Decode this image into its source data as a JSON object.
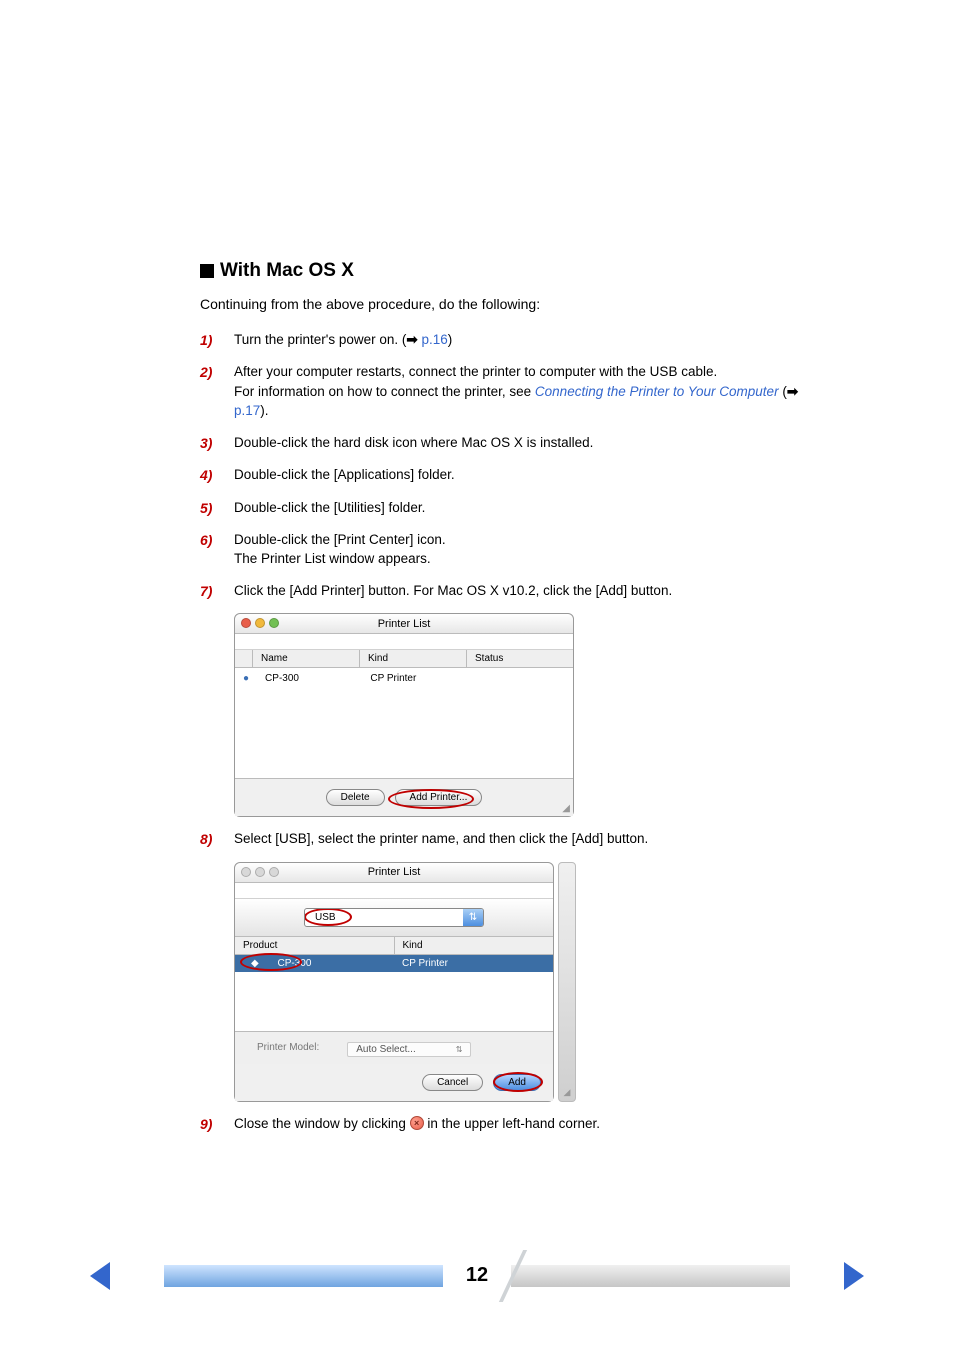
{
  "heading": "With Mac OS X",
  "intro": "Continuing from the above procedure, do the following:",
  "steps": [
    {
      "num": "1)",
      "body": "Turn the printer's power on. (",
      "arrow": "➡",
      "pageRef": "p.16",
      "tail": ")"
    },
    {
      "num": "2)",
      "body": "After your computer restarts, connect the printer to computer with the USB cable.",
      "body2": "For information on how to connect the printer, see ",
      "linkText": "Connecting the Printer to Your Computer",
      "tailArrowOpen": " (",
      "arrow": "➡",
      "pageRef": "p.17",
      "tailArrowClose": ")."
    },
    {
      "num": "3)",
      "body": "Double-click the hard disk icon where Mac OS X is installed."
    },
    {
      "num": "4)",
      "body": "Double-click the [Applications] folder."
    },
    {
      "num": "5)",
      "body": "Double-click the [Utilities] folder."
    },
    {
      "num": "6)",
      "body": "Double-click the [Print Center] icon.",
      "body2": "The Printer List window appears."
    },
    {
      "num": "7)",
      "body": "Click the [Add Printer] button. For Mac OS X v10.2, click the [Add] button."
    },
    {
      "num": "8)",
      "body": "Select [USB], select the printer name, and then click the [Add] button."
    },
    {
      "num": "9)",
      "body_pre": "Close the window by clicking ",
      "body_post": " in the upper left-hand corner."
    }
  ],
  "window1": {
    "title": "Printer List",
    "cols": {
      "name": "Name",
      "kind": "Kind",
      "status": "Status"
    },
    "row": {
      "name": "CP-300",
      "kind": "CP Printer",
      "status": ""
    },
    "delete": "Delete",
    "addPrinter": "Add Printer..."
  },
  "window2": {
    "title": "Printer List",
    "dropdown": "USB",
    "cols": {
      "product": "Product",
      "kind": "Kind"
    },
    "row": {
      "product": "CP-300",
      "kind": "CP Printer"
    },
    "modelLabel": "Printer Model:",
    "modelValue": "Auto Select...",
    "cancel": "Cancel",
    "add": "Add"
  },
  "pageNumber": "12"
}
